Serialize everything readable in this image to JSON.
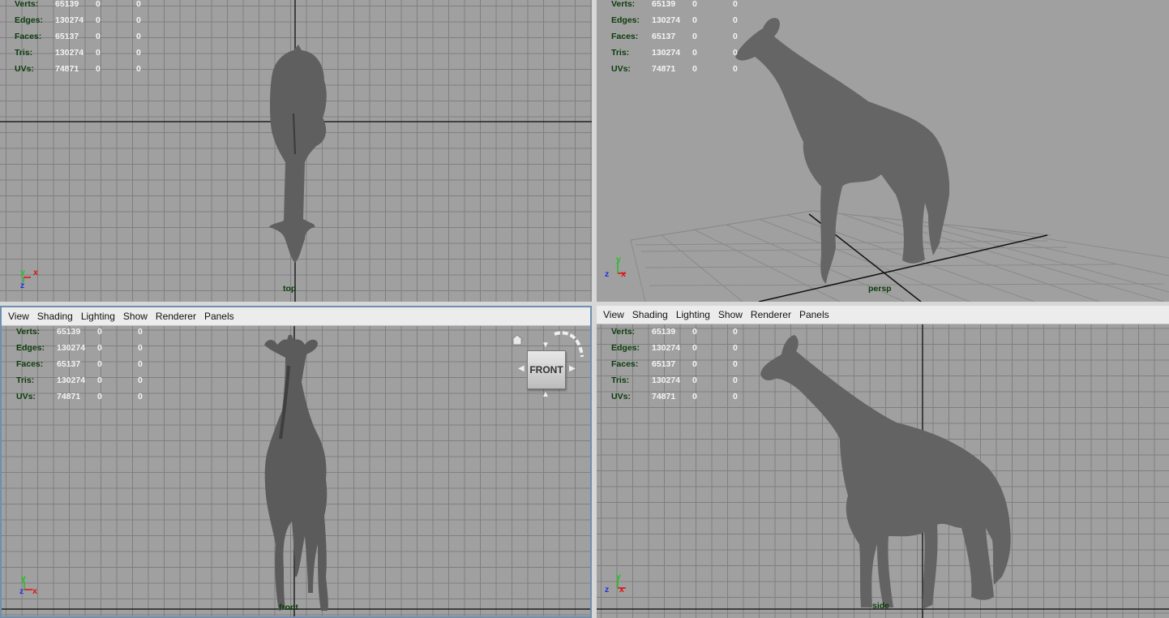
{
  "menu": [
    "View",
    "Shading",
    "Lighting",
    "Show",
    "Renderer",
    "Panels"
  ],
  "hud": [
    {
      "label": "Verts:",
      "v1": "65139",
      "v2": "0",
      "v3": "0"
    },
    {
      "label": "Edges:",
      "v1": "130274",
      "v2": "0",
      "v3": "0"
    },
    {
      "label": "Faces:",
      "v1": "65137",
      "v2": "0",
      "v3": "0"
    },
    {
      "label": "Tris:",
      "v1": "130274",
      "v2": "0",
      "v3": "0"
    },
    {
      "label": "UVs:",
      "v1": "74871",
      "v2": "0",
      "v3": "0"
    }
  ],
  "cameras": {
    "top": "top",
    "persp": "persp",
    "front": "front",
    "side": "side"
  },
  "viewcube": {
    "face": "FRONT"
  },
  "axes": {
    "x": "x",
    "y": "y",
    "z": "z"
  },
  "colors": {
    "viewport_bg": "#a0a0a0",
    "grid": "#7f7f7f",
    "hud_label": "#0b3b0b",
    "hud_value": "#f4f4f4",
    "axis_x": "#e01010",
    "axis_y": "#20c020",
    "axis_z": "#2030e0",
    "model": "#5f5f5f"
  }
}
